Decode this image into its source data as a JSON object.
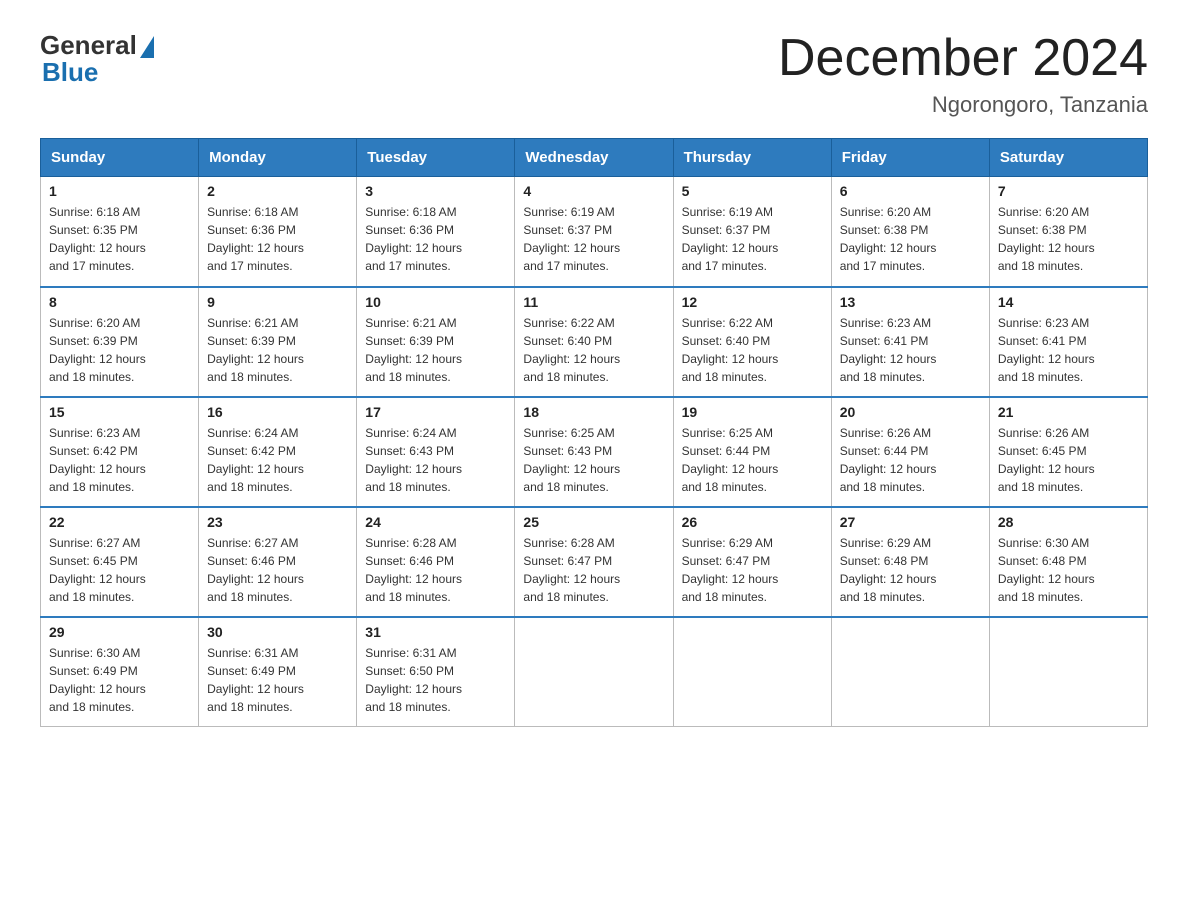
{
  "logo": {
    "general": "General",
    "blue": "Blue"
  },
  "title": "December 2024",
  "location": "Ngorongoro, Tanzania",
  "headers": [
    "Sunday",
    "Monday",
    "Tuesday",
    "Wednesday",
    "Thursday",
    "Friday",
    "Saturday"
  ],
  "weeks": [
    [
      {
        "day": "1",
        "sunrise": "6:18 AM",
        "sunset": "6:35 PM",
        "daylight": "12 hours and 17 minutes."
      },
      {
        "day": "2",
        "sunrise": "6:18 AM",
        "sunset": "6:36 PM",
        "daylight": "12 hours and 17 minutes."
      },
      {
        "day": "3",
        "sunrise": "6:18 AM",
        "sunset": "6:36 PM",
        "daylight": "12 hours and 17 minutes."
      },
      {
        "day": "4",
        "sunrise": "6:19 AM",
        "sunset": "6:37 PM",
        "daylight": "12 hours and 17 minutes."
      },
      {
        "day": "5",
        "sunrise": "6:19 AM",
        "sunset": "6:37 PM",
        "daylight": "12 hours and 17 minutes."
      },
      {
        "day": "6",
        "sunrise": "6:20 AM",
        "sunset": "6:38 PM",
        "daylight": "12 hours and 17 minutes."
      },
      {
        "day": "7",
        "sunrise": "6:20 AM",
        "sunset": "6:38 PM",
        "daylight": "12 hours and 18 minutes."
      }
    ],
    [
      {
        "day": "8",
        "sunrise": "6:20 AM",
        "sunset": "6:39 PM",
        "daylight": "12 hours and 18 minutes."
      },
      {
        "day": "9",
        "sunrise": "6:21 AM",
        "sunset": "6:39 PM",
        "daylight": "12 hours and 18 minutes."
      },
      {
        "day": "10",
        "sunrise": "6:21 AM",
        "sunset": "6:39 PM",
        "daylight": "12 hours and 18 minutes."
      },
      {
        "day": "11",
        "sunrise": "6:22 AM",
        "sunset": "6:40 PM",
        "daylight": "12 hours and 18 minutes."
      },
      {
        "day": "12",
        "sunrise": "6:22 AM",
        "sunset": "6:40 PM",
        "daylight": "12 hours and 18 minutes."
      },
      {
        "day": "13",
        "sunrise": "6:23 AM",
        "sunset": "6:41 PM",
        "daylight": "12 hours and 18 minutes."
      },
      {
        "day": "14",
        "sunrise": "6:23 AM",
        "sunset": "6:41 PM",
        "daylight": "12 hours and 18 minutes."
      }
    ],
    [
      {
        "day": "15",
        "sunrise": "6:23 AM",
        "sunset": "6:42 PM",
        "daylight": "12 hours and 18 minutes."
      },
      {
        "day": "16",
        "sunrise": "6:24 AM",
        "sunset": "6:42 PM",
        "daylight": "12 hours and 18 minutes."
      },
      {
        "day": "17",
        "sunrise": "6:24 AM",
        "sunset": "6:43 PM",
        "daylight": "12 hours and 18 minutes."
      },
      {
        "day": "18",
        "sunrise": "6:25 AM",
        "sunset": "6:43 PM",
        "daylight": "12 hours and 18 minutes."
      },
      {
        "day": "19",
        "sunrise": "6:25 AM",
        "sunset": "6:44 PM",
        "daylight": "12 hours and 18 minutes."
      },
      {
        "day": "20",
        "sunrise": "6:26 AM",
        "sunset": "6:44 PM",
        "daylight": "12 hours and 18 minutes."
      },
      {
        "day": "21",
        "sunrise": "6:26 AM",
        "sunset": "6:45 PM",
        "daylight": "12 hours and 18 minutes."
      }
    ],
    [
      {
        "day": "22",
        "sunrise": "6:27 AM",
        "sunset": "6:45 PM",
        "daylight": "12 hours and 18 minutes."
      },
      {
        "day": "23",
        "sunrise": "6:27 AM",
        "sunset": "6:46 PM",
        "daylight": "12 hours and 18 minutes."
      },
      {
        "day": "24",
        "sunrise": "6:28 AM",
        "sunset": "6:46 PM",
        "daylight": "12 hours and 18 minutes."
      },
      {
        "day": "25",
        "sunrise": "6:28 AM",
        "sunset": "6:47 PM",
        "daylight": "12 hours and 18 minutes."
      },
      {
        "day": "26",
        "sunrise": "6:29 AM",
        "sunset": "6:47 PM",
        "daylight": "12 hours and 18 minutes."
      },
      {
        "day": "27",
        "sunrise": "6:29 AM",
        "sunset": "6:48 PM",
        "daylight": "12 hours and 18 minutes."
      },
      {
        "day": "28",
        "sunrise": "6:30 AM",
        "sunset": "6:48 PM",
        "daylight": "12 hours and 18 minutes."
      }
    ],
    [
      {
        "day": "29",
        "sunrise": "6:30 AM",
        "sunset": "6:49 PM",
        "daylight": "12 hours and 18 minutes."
      },
      {
        "day": "30",
        "sunrise": "6:31 AM",
        "sunset": "6:49 PM",
        "daylight": "12 hours and 18 minutes."
      },
      {
        "day": "31",
        "sunrise": "6:31 AM",
        "sunset": "6:50 PM",
        "daylight": "12 hours and 18 minutes."
      },
      null,
      null,
      null,
      null
    ]
  ],
  "labels": {
    "sunrise": "Sunrise:",
    "sunset": "Sunset:",
    "daylight": "Daylight:"
  }
}
